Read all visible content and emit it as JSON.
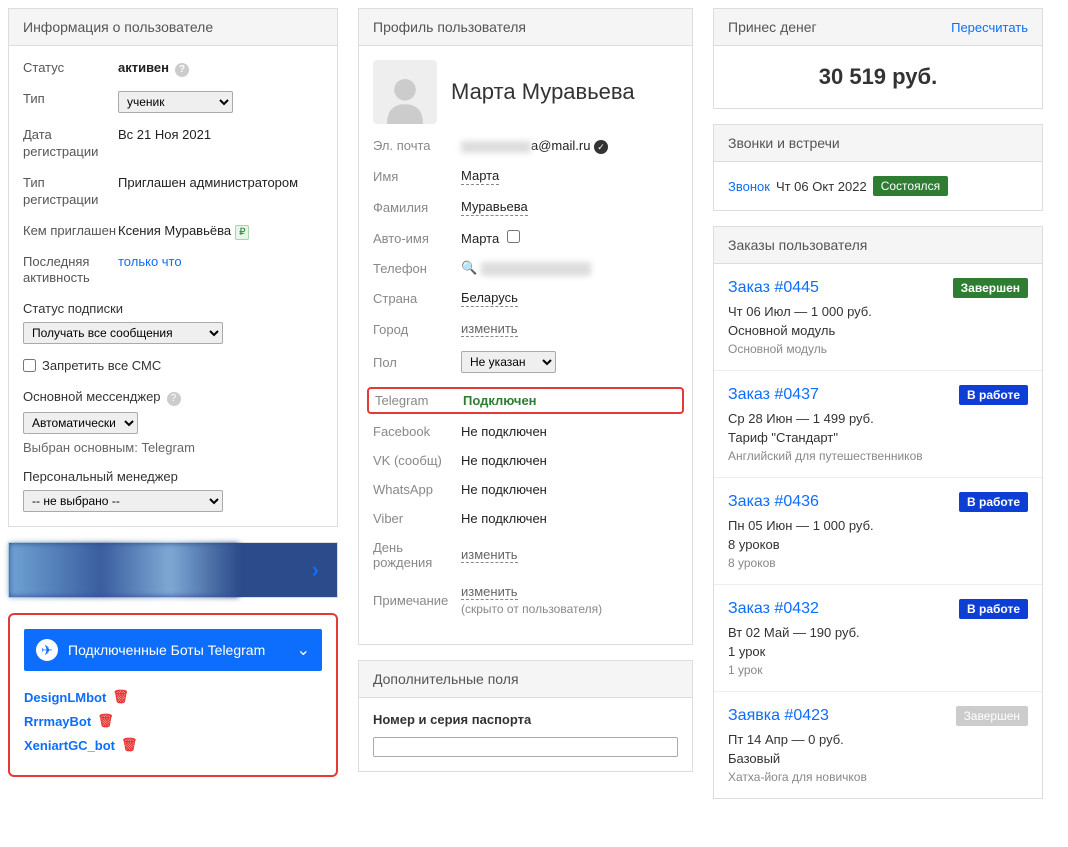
{
  "left": {
    "header": "Информация о пользователе",
    "status_label": "Статус",
    "status_value": "активен",
    "type_label": "Тип",
    "type_value": "ученик",
    "regdate_label": "Дата регистрации",
    "regdate_value": "Вс 21 Ноя 2021",
    "regtype_label": "Тип регистрации",
    "regtype_value": "Приглашен администратором",
    "invitedby_label": "Кем приглашен",
    "invitedby_value": "Ксения Муравьёва",
    "lastact_label": "Последняя активность",
    "lastact_value": "только что",
    "substatus_label": "Статус подписки",
    "substatus_value": "Получать все сообщения",
    "forbid_sms": "Запретить все СМС",
    "main_messenger_label": "Основной мессенджер",
    "main_messenger_value": "Автоматически",
    "main_messenger_note": "Выбран основным: Telegram",
    "pm_label": "Персональный менеджер",
    "pm_value": "-- не выбрано --",
    "tg_bar": "Подключенные Боты Telegram",
    "bots": [
      "DesignLMbot",
      "RrrmayBot",
      "XeniartGC_bot"
    ]
  },
  "mid": {
    "header": "Профиль пользователя",
    "fullname": "Марта Муравьева",
    "email_label": "Эл. почта",
    "email_suffix": "a@mail.ru",
    "name_label": "Имя",
    "name_value": "Марта",
    "surname_label": "Фамилия",
    "surname_value": "Муравьева",
    "autoname_label": "Авто-имя",
    "autoname_value": "Марта",
    "phone_label": "Телефон",
    "country_label": "Страна",
    "country_value": "Беларусь",
    "city_label": "Город",
    "city_value": "изменить",
    "gender_label": "Пол",
    "gender_value": "Не указан",
    "telegram_label": "Telegram",
    "telegram_value": "Подключен",
    "facebook_label": "Facebook",
    "facebook_value": "Не подключен",
    "vk_label": "VK (сообщ)",
    "vk_value": "Не подключен",
    "whatsapp_label": "WhatsApp",
    "whatsapp_value": "Не подключен",
    "viber_label": "Viber",
    "viber_value": "Не подключен",
    "birthday_label": "День рождения",
    "birthday_value": "изменить",
    "note_label": "Примечание",
    "note_value": "изменить",
    "note_sub": "(скрыто от пользователя)",
    "extra_header": "Дополнительные поля",
    "passport_label": "Номер и серия паспорта"
  },
  "right": {
    "money_header": "Принес денег",
    "recalc": "Пересчитать",
    "money_value": "30 519 руб.",
    "calls_header": "Звонки и встречи",
    "call_type": "Звонок",
    "call_date": "Чт 06 Окт 2022",
    "call_status": "Состоялся",
    "orders_header": "Заказы пользователя",
    "orders": [
      {
        "title": "Заказ #0445",
        "status": "Завершен",
        "status_kind": "green",
        "date": "Чт 06 Июл — 1 000 руб.",
        "line": "Основной модуль",
        "sub": "Основной модуль"
      },
      {
        "title": "Заказ #0437",
        "status": "В работе",
        "status_kind": "blue",
        "date": "Ср 28 Июн — 1 499 руб.",
        "line": "Тариф \"Стандарт\"",
        "sub": "Английский для путешественников"
      },
      {
        "title": "Заказ #0436",
        "status": "В работе",
        "status_kind": "blue",
        "date": "Пн 05 Июн — 1 000 руб.",
        "line": "8 уроков",
        "sub": "8 уроков"
      },
      {
        "title": "Заказ #0432",
        "status": "В работе",
        "status_kind": "blue",
        "date": "Вт 02 Май — 190 руб.",
        "line": "1 урок",
        "sub": "1 урок"
      },
      {
        "title": "Заявка #0423",
        "status": "Завершен",
        "status_kind": "grey",
        "date": "Пт 14 Апр — 0 руб.",
        "line": "Базовый",
        "sub": "Хатха-йога для новичков"
      }
    ]
  }
}
